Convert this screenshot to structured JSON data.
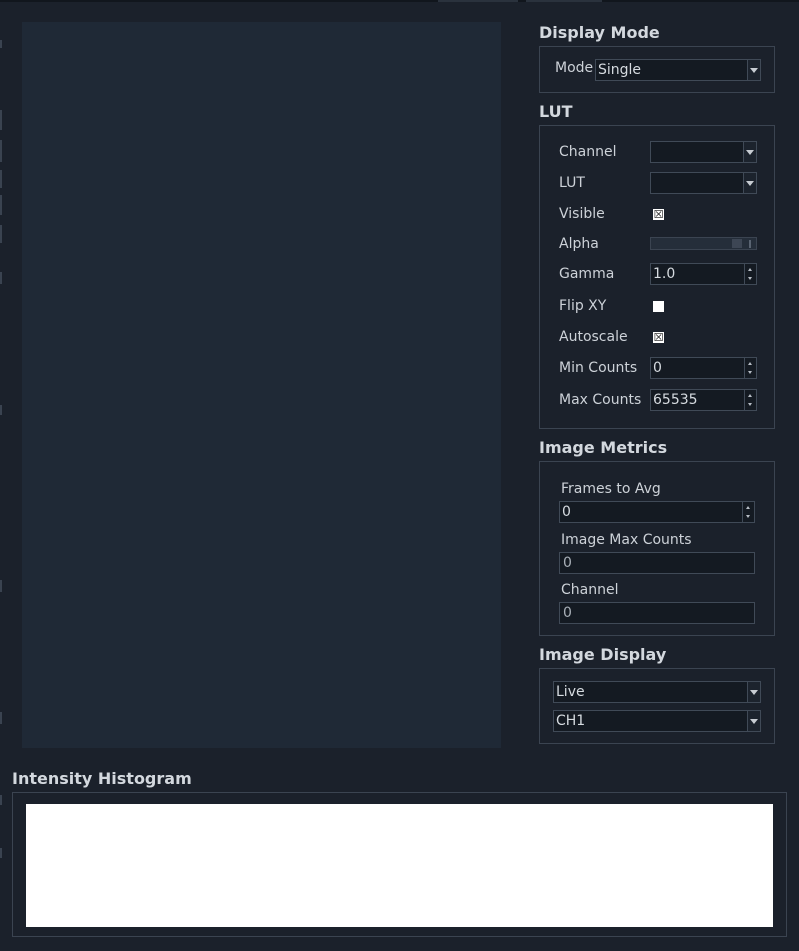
{
  "display_mode": {
    "title": "Display Mode",
    "mode_label": "Mode",
    "mode_value": "Single"
  },
  "lut": {
    "title": "LUT",
    "channel_label": "Channel",
    "channel_value": "",
    "lut_label": "LUT",
    "lut_value": "",
    "visible_label": "Visible",
    "visible_checked": true,
    "alpha_label": "Alpha",
    "alpha_fraction": 0.85,
    "gamma_label": "Gamma",
    "gamma_value": "1.0",
    "flip_label": "Flip XY",
    "flip_checked": false,
    "autoscale_label": "Autoscale",
    "autoscale_checked": true,
    "min_label": "Min Counts",
    "min_value": "0",
    "max_label": "Max Counts",
    "max_value": "65535"
  },
  "image_metrics": {
    "title": "Image Metrics",
    "frames_label": "Frames to Avg",
    "frames_value": "0",
    "max_counts_label": "Image Max Counts",
    "max_counts_value": "0",
    "channel_label": "Channel",
    "channel_value": "0"
  },
  "image_display": {
    "title": "Image Display",
    "source_value": "Live",
    "channel_value": "CH1"
  },
  "histogram": {
    "title": "Intensity Histogram"
  },
  "colors": {
    "background": "#1b212b",
    "viewport": "#1f2936",
    "group_border": "#3b4451",
    "histogram_bg": "#ffffff"
  }
}
